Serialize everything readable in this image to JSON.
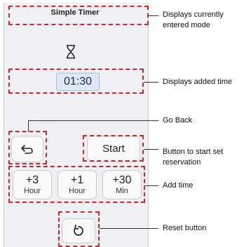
{
  "app": {
    "title": "Simple Timer"
  },
  "display": {
    "time": "01:30"
  },
  "controls": {
    "back_icon": "back-arrow-icon",
    "start_label": "Start",
    "add_hour_value": "+3",
    "add_hour_unit": "Hour",
    "add_one_hour_value": "+1",
    "add_one_hour_unit": "Hour",
    "add_min_value": "+30",
    "add_min_unit": "Min",
    "reset_icon": "reset-icon"
  },
  "annotations": {
    "mode": "Displays currently entered mode",
    "added_time": "Displays added time",
    "go_back": "Go Back",
    "start": "Button to start set reservation",
    "add_time": "Add time",
    "reset": "Reset button"
  },
  "colors": {
    "highlight": "#d0262f",
    "panel": "#eef0f3"
  }
}
